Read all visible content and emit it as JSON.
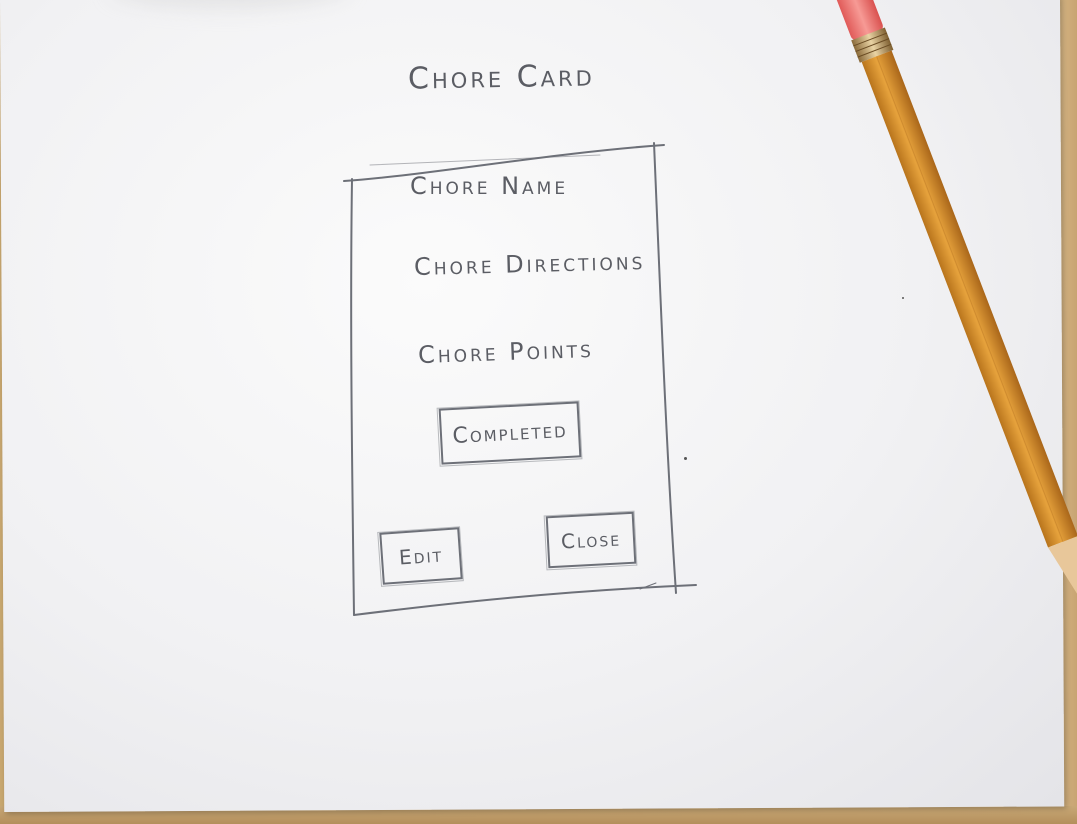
{
  "sketch": {
    "title": "Chore Card",
    "card": {
      "fields": {
        "name": "Chore Name",
        "directions": "Chore Directions",
        "points": "Chore Points"
      },
      "buttons": {
        "completed": "Completed",
        "edit": "Edit",
        "close": "Close"
      }
    }
  },
  "colors": {
    "pencil_lead": "#5b5d64",
    "paper": "#f3f3f5",
    "pencil_body": "#d6902c",
    "eraser": "#ee6f6c",
    "table": "#c9a870"
  }
}
